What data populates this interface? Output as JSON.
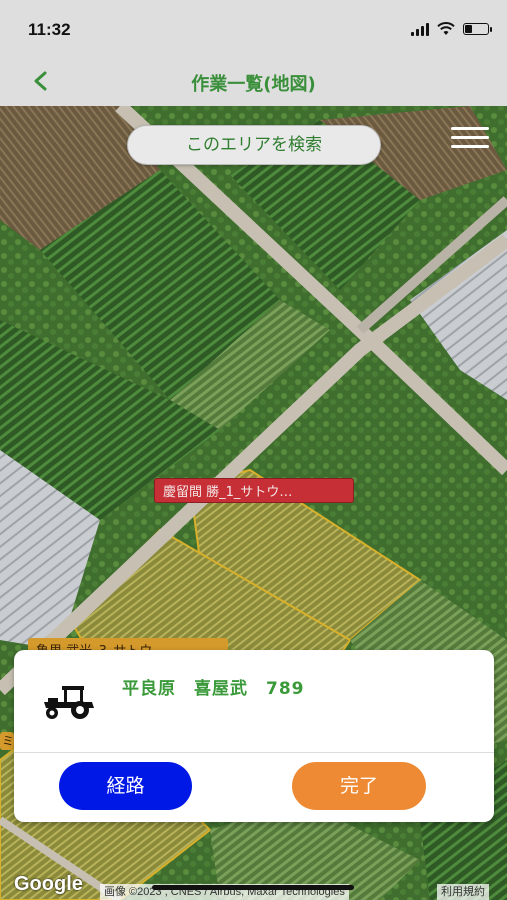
{
  "status_bar": {
    "time": "11:32",
    "battery_level": 0.3
  },
  "header": {
    "back_icon": "chevron-left-icon",
    "back_glyph": "<",
    "title": "作業一覧(地図)"
  },
  "map": {
    "search_button_label": "このエリアを検索",
    "menu_icon": "hamburger-menu-icon",
    "field_labels": [
      {
        "text": "慶留間 勝_1_サトウ…",
        "color": "#c62f35"
      },
      {
        "text": "亀里 武光_3_サトウ…",
        "color": "#d49a2b"
      },
      {
        "text": "ミ",
        "color": "#d49a2b"
      }
    ],
    "google_logo": "Google",
    "attribution": "画像 ©2023 , CNES / Airbus, Maxar Technologies",
    "terms_label": "利用規約"
  },
  "task_card": {
    "icon": "tractor-icon",
    "name_part1": "平良原",
    "name_part2": "喜屋武",
    "number": "789",
    "route_button_label": "経路",
    "done_button_label": "完了",
    "route_button_color": "#0018e6",
    "done_button_color": "#ee8a34",
    "title_color": "#3a9a3a"
  }
}
